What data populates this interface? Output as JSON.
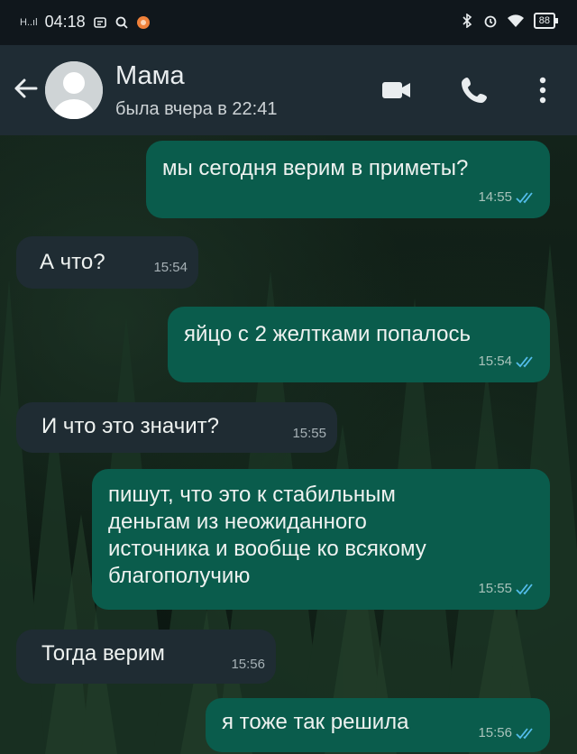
{
  "status_bar": {
    "network": "H..ıl",
    "time": "04:18",
    "battery": "88"
  },
  "header": {
    "contact_name": "Мама",
    "last_seen": "была вчера в 22:41"
  },
  "messages": [
    {
      "direction": "outgoing",
      "text": "мы сегодня верим в приметы?",
      "time": "14:55",
      "read": true
    },
    {
      "direction": "incoming",
      "text": "А что?",
      "time": "15:54"
    },
    {
      "direction": "outgoing",
      "text": "яйцо с 2 желтками попалось",
      "time": "15:54",
      "read": true
    },
    {
      "direction": "incoming",
      "text": "И что это значит?",
      "time": "15:55"
    },
    {
      "direction": "outgoing",
      "text_lines": [
        "пишут, что это к стабильным",
        "деньгам из неожиданного",
        "источника и вообще ко всякому",
        "благополучию"
      ],
      "time": "15:55",
      "read": true
    },
    {
      "direction": "incoming",
      "text": "Тогда верим",
      "time": "15:56"
    },
    {
      "direction": "outgoing",
      "text": "я тоже так решила",
      "time": "15:56",
      "read": true
    }
  ],
  "colors": {
    "header_bg": "#1f2c34",
    "outgoing_bubble": "#0a5c4c",
    "incoming_bubble": "#1f2c33",
    "read_ticks": "#53bdeb"
  },
  "icons": [
    "back-arrow-icon",
    "avatar-placeholder-icon",
    "video-call-icon",
    "voice-call-icon",
    "more-options-icon",
    "bluetooth-icon",
    "alarm-icon",
    "wifi-icon",
    "battery-icon",
    "double-check-icon"
  ]
}
